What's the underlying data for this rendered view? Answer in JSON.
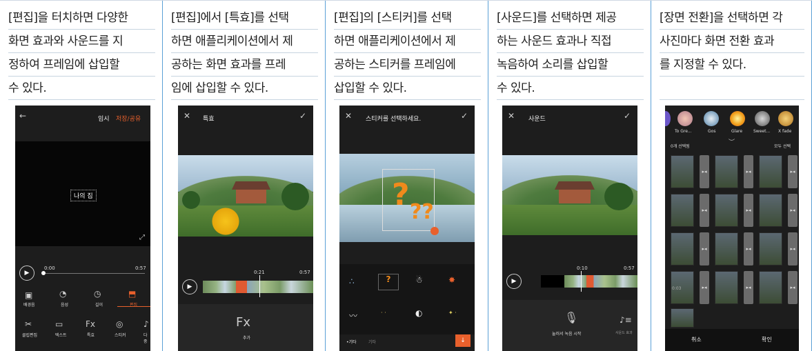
{
  "columns": [
    {
      "lines": [
        "[편집]을 터치하면 다양한",
        "화면 효과와 사운드를 지",
        "정하여 프레임에 삽입할",
        "수 있다."
      ],
      "screen": {
        "header_right_1": "임시",
        "header_right_2": "저장/공유",
        "caption_text": "나의 집",
        "time_start": "0:00",
        "time_end": "0:57",
        "tools_top": [
          "배경음",
          "음성",
          "길이",
          "편집"
        ],
        "tools_bottom": [
          "클립편집",
          "텍스트",
          "특효",
          "스티커",
          "다중"
        ]
      }
    },
    {
      "lines": [
        "[편집]에서 [특효]를 선택",
        "하면 애플리케이션에서 제",
        "공하는 화면 효과를 프레",
        "임에 삽입할 수 있다."
      ],
      "screen": {
        "title": "특효",
        "time_mid": "0:21",
        "time_end": "0:57",
        "fx_icon": "Fx",
        "fx_label": "추가"
      }
    },
    {
      "lines": [
        "[편집]의 [스티커]를 선택",
        "하면 애플리케이션에서 제",
        "공하는 스티커를 프레임에",
        "삽입할 수 있다."
      ],
      "screen": {
        "title": "스티커를 선택하세요.",
        "tab_1": "•기타",
        "tab_2": "기타"
      }
    },
    {
      "lines": [
        "[사운드]를 선택하면 제공",
        "하는 사운드 효과나 직접",
        "녹음하여 소리를 삽입할",
        "수 있다."
      ],
      "screen": {
        "title": "사운드",
        "time_mid": "0:10",
        "time_end": "0:57",
        "record_label": "눌러서 녹음 시작",
        "effect_label": "사운드 효과"
      }
    },
    {
      "lines": [
        "[장면 전환]을 선택하면 각",
        "사진마다 화면 전환 효과",
        "를 지정할 수 있다.",
        ""
      ],
      "screen": {
        "transitions": [
          "To Gre...",
          "Gos",
          "Glare",
          "Sweet...",
          "X fade"
        ],
        "selected_count": "0개 선택됨",
        "select_all": "모두 선택",
        "thumb_time": "0:03",
        "cancel": "취소",
        "confirm": "확인"
      }
    }
  ],
  "colors": {
    "accent": "#e8602c",
    "border_blue": "#5aa0d6",
    "phone_bg": "#1d1d1d"
  }
}
